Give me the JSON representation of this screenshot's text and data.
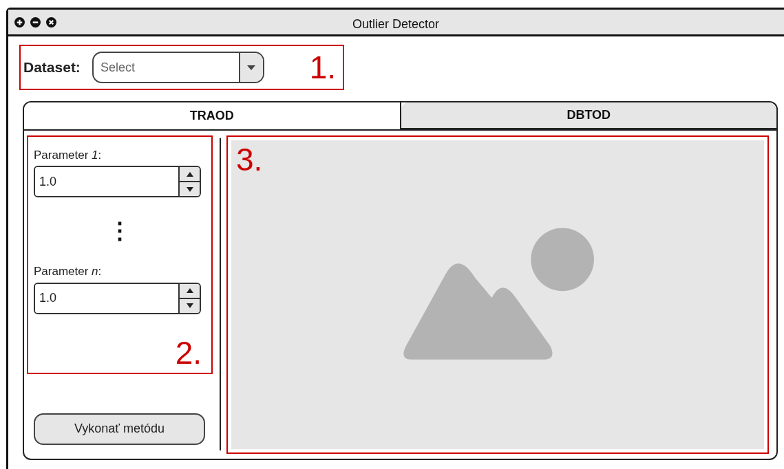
{
  "window": {
    "title": "Outlier Detector"
  },
  "dataset": {
    "label": "Dataset:",
    "placeholder": "Select",
    "annotation": "1."
  },
  "tabs": [
    {
      "label": "TRAOD",
      "selected": true
    },
    {
      "label": "DBTOD",
      "selected": false
    }
  ],
  "parameters": {
    "annotation": "2.",
    "ellipsis": "⋮",
    "items": [
      {
        "label": "Parameter *1*:",
        "value": "1.0"
      },
      {
        "label": "Parameter *n*:",
        "value": "1.0"
      }
    ]
  },
  "run_button": "Vykonať metódu",
  "output": {
    "annotation": "3.",
    "kind": "picture"
  }
}
